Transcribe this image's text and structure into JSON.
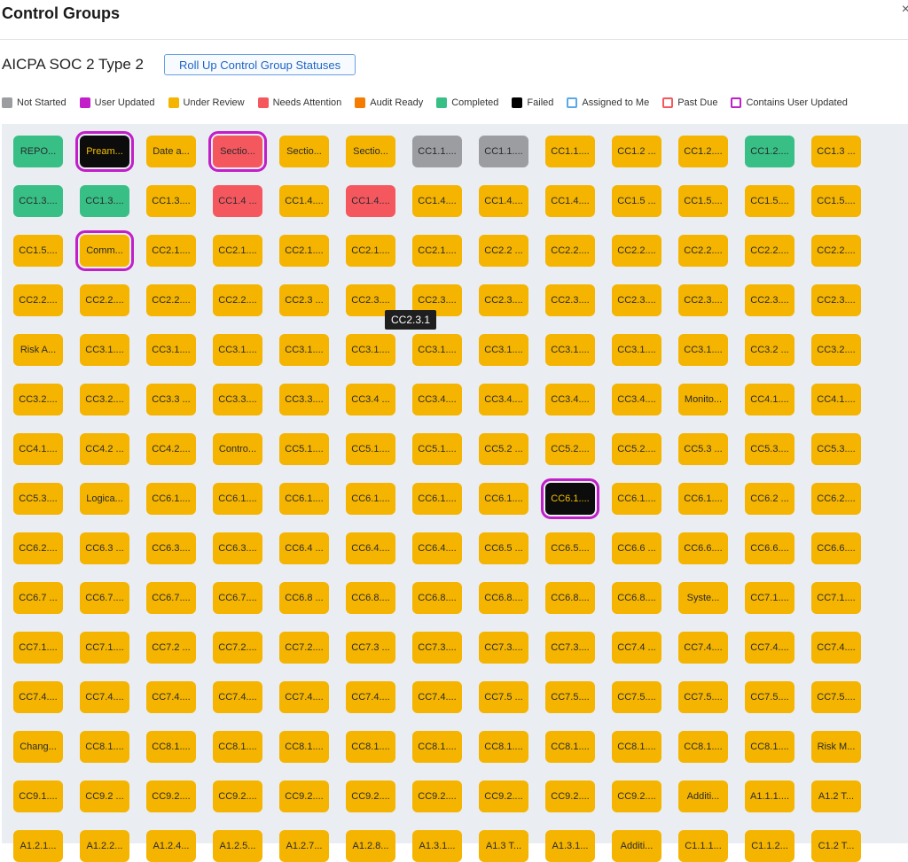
{
  "header": {
    "title": "Control Groups",
    "close": "×"
  },
  "framework": {
    "name": "AICPA SOC 2 Type 2",
    "rollup_label": "Roll Up Control Group Statuses"
  },
  "legend": [
    {
      "label": "Not Started",
      "color": "#9b9da0",
      "style": "fill"
    },
    {
      "label": "User Updated",
      "color": "#c21ec9",
      "style": "fill"
    },
    {
      "label": "Under Review",
      "color": "#f4b400",
      "style": "fill"
    },
    {
      "label": "Needs Attention",
      "color": "#f5575f",
      "style": "fill"
    },
    {
      "label": "Audit Ready",
      "color": "#f57c00",
      "style": "fill"
    },
    {
      "label": "Completed",
      "color": "#37bf86",
      "style": "fill"
    },
    {
      "label": "Failed",
      "color": "#000000",
      "style": "fill"
    },
    {
      "label": "Assigned to Me",
      "color": "#5aa9e6",
      "style": "outline"
    },
    {
      "label": "Past Due",
      "color": "#f5575f",
      "style": "outline"
    },
    {
      "label": "Contains User Updated",
      "color": "#c21ec9",
      "style": "outline"
    }
  ],
  "tooltip": "CC2.3.1",
  "grid": [
    [
      [
        "REPO...",
        "done"
      ],
      [
        "Pream...",
        "failed",
        1
      ],
      [
        "Date a...",
        "review"
      ],
      [
        "Sectio...",
        "attn",
        1
      ],
      [
        "Sectio...",
        "review"
      ],
      [
        "Sectio...",
        "review"
      ],
      [
        "CC1.1....",
        "gray"
      ],
      [
        "CC1.1....",
        "gray"
      ],
      [
        "CC1.1....",
        "review"
      ],
      [
        "CC1.2 ...",
        "review"
      ],
      [
        "CC1.2....",
        "review"
      ],
      [
        "CC1.2....",
        "done"
      ],
      [
        "CC1.3 ...",
        "review"
      ]
    ],
    [
      [
        "CC1.3....",
        "done"
      ],
      [
        "CC1.3....",
        "done"
      ],
      [
        "CC1.3....",
        "review"
      ],
      [
        "CC1.4 ...",
        "attn"
      ],
      [
        "CC1.4....",
        "review"
      ],
      [
        "CC1.4....",
        "attn"
      ],
      [
        "CC1.4....",
        "review"
      ],
      [
        "CC1.4....",
        "review"
      ],
      [
        "CC1.4....",
        "review"
      ],
      [
        "CC1.5 ...",
        "review"
      ],
      [
        "CC1.5....",
        "review"
      ],
      [
        "CC1.5....",
        "review"
      ],
      [
        "CC1.5....",
        "review"
      ]
    ],
    [
      [
        "CC1.5....",
        "review"
      ],
      [
        "Comm...",
        "review",
        1
      ],
      [
        "CC2.1....",
        "review"
      ],
      [
        "CC2.1....",
        "review"
      ],
      [
        "CC2.1....",
        "review"
      ],
      [
        "CC2.1....",
        "review"
      ],
      [
        "CC2.1....",
        "review"
      ],
      [
        "CC2.2 ...",
        "review"
      ],
      [
        "CC2.2....",
        "review"
      ],
      [
        "CC2.2....",
        "review"
      ],
      [
        "CC2.2....",
        "review"
      ],
      [
        "CC2.2....",
        "review"
      ],
      [
        "CC2.2....",
        "review"
      ]
    ],
    [
      [
        "CC2.2....",
        "review"
      ],
      [
        "CC2.2....",
        "review"
      ],
      [
        "CC2.2....",
        "review"
      ],
      [
        "CC2.2....",
        "review"
      ],
      [
        "CC2.3 ...",
        "review"
      ],
      [
        "CC2.3....",
        "review"
      ],
      [
        "CC2.3....",
        "review"
      ],
      [
        "CC2.3....",
        "review"
      ],
      [
        "CC2.3....",
        "review"
      ],
      [
        "CC2.3....",
        "review"
      ],
      [
        "CC2.3....",
        "review"
      ],
      [
        "CC2.3....",
        "review"
      ],
      [
        "CC2.3....",
        "review"
      ]
    ],
    [
      [
        "Risk A...",
        "review"
      ],
      [
        "CC3.1....",
        "review"
      ],
      [
        "CC3.1....",
        "review"
      ],
      [
        "CC3.1....",
        "review"
      ],
      [
        "CC3.1....",
        "review"
      ],
      [
        "CC3.1....",
        "review"
      ],
      [
        "CC3.1....",
        "review"
      ],
      [
        "CC3.1....",
        "review"
      ],
      [
        "CC3.1....",
        "review"
      ],
      [
        "CC3.1....",
        "review"
      ],
      [
        "CC3.1....",
        "review"
      ],
      [
        "CC3.2 ...",
        "review"
      ],
      [
        "CC3.2....",
        "review"
      ]
    ],
    [
      [
        "CC3.2....",
        "review"
      ],
      [
        "CC3.2....",
        "review"
      ],
      [
        "CC3.3 ...",
        "review"
      ],
      [
        "CC3.3....",
        "review"
      ],
      [
        "CC3.3....",
        "review"
      ],
      [
        "CC3.4 ...",
        "review"
      ],
      [
        "CC3.4....",
        "review"
      ],
      [
        "CC3.4....",
        "review"
      ],
      [
        "CC3.4....",
        "review"
      ],
      [
        "CC3.4....",
        "review"
      ],
      [
        "Monito...",
        "review"
      ],
      [
        "CC4.1....",
        "review"
      ],
      [
        "CC4.1....",
        "review"
      ]
    ],
    [
      [
        "CC4.1....",
        "review"
      ],
      [
        "CC4.2 ...",
        "review"
      ],
      [
        "CC4.2....",
        "review"
      ],
      [
        "Contro...",
        "review"
      ],
      [
        "CC5.1....",
        "review"
      ],
      [
        "CC5.1....",
        "review"
      ],
      [
        "CC5.1....",
        "review"
      ],
      [
        "CC5.2 ...",
        "review"
      ],
      [
        "CC5.2....",
        "review"
      ],
      [
        "CC5.2....",
        "review"
      ],
      [
        "CC5.3 ...",
        "review"
      ],
      [
        "CC5.3....",
        "review"
      ],
      [
        "CC5.3....",
        "review"
      ]
    ],
    [
      [
        "CC5.3....",
        "review"
      ],
      [
        "Logica...",
        "review"
      ],
      [
        "CC6.1....",
        "review"
      ],
      [
        "CC6.1....",
        "review"
      ],
      [
        "CC6.1....",
        "review"
      ],
      [
        "CC6.1....",
        "review"
      ],
      [
        "CC6.1....",
        "review"
      ],
      [
        "CC6.1....",
        "review"
      ],
      [
        "CC6.1....",
        "failed",
        1
      ],
      [
        "CC6.1....",
        "review"
      ],
      [
        "CC6.1....",
        "review"
      ],
      [
        "CC6.2 ...",
        "review"
      ],
      [
        "CC6.2....",
        "review"
      ]
    ],
    [
      [
        "CC6.2....",
        "review"
      ],
      [
        "CC6.3 ...",
        "review"
      ],
      [
        "CC6.3....",
        "review"
      ],
      [
        "CC6.3....",
        "review"
      ],
      [
        "CC6.4 ...",
        "review"
      ],
      [
        "CC6.4....",
        "review"
      ],
      [
        "CC6.4....",
        "review"
      ],
      [
        "CC6.5 ...",
        "review"
      ],
      [
        "CC6.5....",
        "review"
      ],
      [
        "CC6.6 ...",
        "review"
      ],
      [
        "CC6.6....",
        "review"
      ],
      [
        "CC6.6....",
        "review"
      ],
      [
        "CC6.6....",
        "review"
      ]
    ],
    [
      [
        "CC6.7 ...",
        "review"
      ],
      [
        "CC6.7....",
        "review"
      ],
      [
        "CC6.7....",
        "review"
      ],
      [
        "CC6.7....",
        "review"
      ],
      [
        "CC6.8 ...",
        "review"
      ],
      [
        "CC6.8....",
        "review"
      ],
      [
        "CC6.8....",
        "review"
      ],
      [
        "CC6.8....",
        "review"
      ],
      [
        "CC6.8....",
        "review"
      ],
      [
        "CC6.8....",
        "review"
      ],
      [
        "Syste...",
        "review"
      ],
      [
        "CC7.1....",
        "review"
      ],
      [
        "CC7.1....",
        "review"
      ]
    ],
    [
      [
        "CC7.1....",
        "review"
      ],
      [
        "CC7.1....",
        "review"
      ],
      [
        "CC7.2 ...",
        "review"
      ],
      [
        "CC7.2....",
        "review"
      ],
      [
        "CC7.2....",
        "review"
      ],
      [
        "CC7.3 ...",
        "review"
      ],
      [
        "CC7.3....",
        "review"
      ],
      [
        "CC7.3....",
        "review"
      ],
      [
        "CC7.3....",
        "review"
      ],
      [
        "CC7.4 ...",
        "review"
      ],
      [
        "CC7.4....",
        "review"
      ],
      [
        "CC7.4....",
        "review"
      ],
      [
        "CC7.4....",
        "review"
      ]
    ],
    [
      [
        "CC7.4....",
        "review"
      ],
      [
        "CC7.4....",
        "review"
      ],
      [
        "CC7.4....",
        "review"
      ],
      [
        "CC7.4....",
        "review"
      ],
      [
        "CC7.4....",
        "review"
      ],
      [
        "CC7.4....",
        "review"
      ],
      [
        "CC7.4....",
        "review"
      ],
      [
        "CC7.5 ...",
        "review"
      ],
      [
        "CC7.5....",
        "review"
      ],
      [
        "CC7.5....",
        "review"
      ],
      [
        "CC7.5....",
        "review"
      ],
      [
        "CC7.5....",
        "review"
      ],
      [
        "CC7.5....",
        "review"
      ]
    ],
    [
      [
        "Chang...",
        "review"
      ],
      [
        "CC8.1....",
        "review"
      ],
      [
        "CC8.1....",
        "review"
      ],
      [
        "CC8.1....",
        "review"
      ],
      [
        "CC8.1....",
        "review"
      ],
      [
        "CC8.1....",
        "review"
      ],
      [
        "CC8.1....",
        "review"
      ],
      [
        "CC8.1....",
        "review"
      ],
      [
        "CC8.1....",
        "review"
      ],
      [
        "CC8.1....",
        "review"
      ],
      [
        "CC8.1....",
        "review"
      ],
      [
        "CC8.1....",
        "review"
      ],
      [
        "Risk M...",
        "review"
      ]
    ],
    [
      [
        "CC9.1....",
        "review"
      ],
      [
        "CC9.2 ...",
        "review"
      ],
      [
        "CC9.2....",
        "review"
      ],
      [
        "CC9.2....",
        "review"
      ],
      [
        "CC9.2....",
        "review"
      ],
      [
        "CC9.2....",
        "review"
      ],
      [
        "CC9.2....",
        "review"
      ],
      [
        "CC9.2....",
        "review"
      ],
      [
        "CC9.2....",
        "review"
      ],
      [
        "CC9.2....",
        "review"
      ],
      [
        "Additi...",
        "review"
      ],
      [
        "A1.1.1....",
        "review"
      ],
      [
        "A1.2 T...",
        "review"
      ]
    ],
    [
      [
        "A1.2.1...",
        "review"
      ],
      [
        "A1.2.2...",
        "review"
      ],
      [
        "A1.2.4...",
        "review"
      ],
      [
        "A1.2.5...",
        "review"
      ],
      [
        "A1.2.7...",
        "review"
      ],
      [
        "A1.2.8...",
        "review"
      ],
      [
        "A1.3.1...",
        "review"
      ],
      [
        "A1.3 T...",
        "review"
      ],
      [
        "A1.3.1...",
        "review"
      ],
      [
        "Additi...",
        "review"
      ],
      [
        "C1.1.1...",
        "review"
      ],
      [
        "C1.1.2...",
        "review"
      ],
      [
        "C1.2 T...",
        "review"
      ]
    ]
  ]
}
